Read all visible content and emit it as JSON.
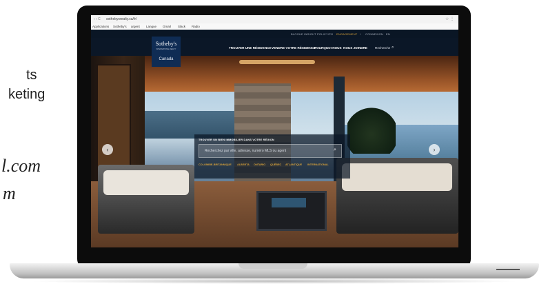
{
  "side": {
    "line1": "ts",
    "line2": "keting",
    "line3": "l.com",
    "line4": "m"
  },
  "browser": {
    "nav": "‹ › C",
    "url": "sothebysrealty.ca/fr/",
    "actions": "☆ ⋮",
    "bookmarks": [
      "Applications",
      "Sotheby's",
      "argent",
      "Langue",
      "Gmail",
      "Slack",
      "Radio"
    ]
  },
  "site": {
    "util_links": [
      {
        "label": "BLOGUE INSIGHT",
        "active": false
      },
      {
        "label": "POLICY/PG",
        "active": false
      },
      {
        "label": "ENGAGEMENT",
        "active": true
      },
      {
        "label": "/",
        "active": false
      },
      {
        "label": "CONNEXION",
        "active": false
      },
      {
        "label": "EN",
        "active": false
      }
    ],
    "logo": {
      "name": "Sotheby's",
      "sub": "INTERNATIONAL REALTY",
      "country": "Canada"
    },
    "nav": [
      "TROUVER UNE RÉSIDENCE",
      "VENDRE VOTRE RÉSIDENCE",
      "POURQUOI NOUS",
      "NOUS JOINDRE"
    ],
    "search_link": "Recherche",
    "search": {
      "title": "TROUVER UN BIEN IMMOBILIER DANS VOTRE RÉGION",
      "placeholder": "Recherchez par ville, adresse, numéro MLS ou agent",
      "regions": [
        "COLOMBIE-BRITANNIQUE",
        "ALBERTA",
        "ONTARIO",
        "QUÉBEC",
        "ATLANTIQUE",
        "INTERNATIONAL"
      ]
    },
    "arrows": {
      "prev": "‹",
      "next": "›"
    }
  }
}
